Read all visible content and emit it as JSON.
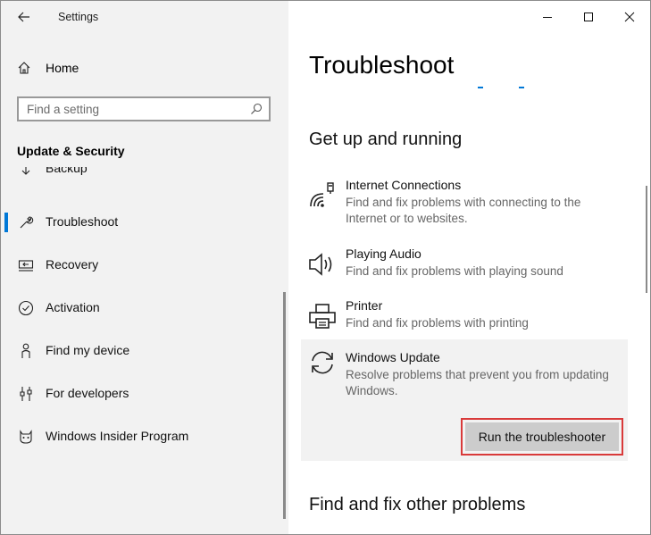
{
  "window": {
    "title": "Settings",
    "controls": [
      "minimize",
      "maximize",
      "close"
    ]
  },
  "sidebar": {
    "home_label": "Home",
    "search_placeholder": "Find a setting",
    "section_title": "Update & Security",
    "items": [
      {
        "label": "Backup",
        "icon": "backup-icon",
        "active": false
      },
      {
        "label": "Troubleshoot",
        "icon": "wrench-icon",
        "active": true
      },
      {
        "label": "Recovery",
        "icon": "recovery-icon",
        "active": false
      },
      {
        "label": "Activation",
        "icon": "activation-check-icon",
        "active": false
      },
      {
        "label": "Find my device",
        "icon": "person-location-icon",
        "active": false
      },
      {
        "label": "For developers",
        "icon": "developer-tools-icon",
        "active": false
      },
      {
        "label": "Windows Insider Program",
        "icon": "insider-cat-icon",
        "active": false
      }
    ]
  },
  "main": {
    "page_title": "Troubleshoot",
    "section1_title": "Get up and running",
    "troubleshooters": [
      {
        "name": "Internet Connections",
        "desc": "Find and fix problems with connecting to the Internet or to websites.",
        "icon": "network-icon"
      },
      {
        "name": "Playing Audio",
        "desc": "Find and fix problems with playing sound",
        "icon": "speaker-icon"
      },
      {
        "name": "Printer",
        "desc": "Find and fix problems with printing",
        "icon": "printer-icon"
      },
      {
        "name": "Windows Update",
        "desc": "Resolve problems that prevent you from updating Windows.",
        "icon": "sync-icon",
        "selected": true
      }
    ],
    "run_button": "Run the troubleshooter",
    "section2_title": "Find and fix other problems"
  },
  "colors": {
    "accent": "#0078d7",
    "sidebar_bg": "#f2f2f2",
    "highlight_box": "#d93a3a"
  }
}
